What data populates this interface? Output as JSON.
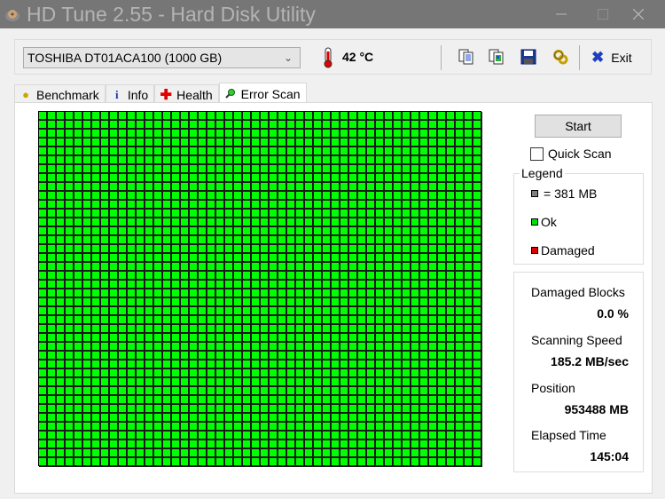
{
  "window": {
    "title": "HD Tune 2.55 - Hard Disk Utility",
    "controls": {
      "minimize": "—",
      "maximize": "☐",
      "close": "✕"
    }
  },
  "toolbar": {
    "drive": "TOSHIBA DT01ACA100 (1000 GB)",
    "temperature": "42 °C",
    "icons": [
      "copy-text-icon",
      "copy-screenshot-icon",
      "save-icon",
      "options-icon"
    ],
    "exit_label": "Exit"
  },
  "tabs": [
    {
      "label": "Benchmark",
      "icon": "benchmark-icon",
      "active": false
    },
    {
      "label": "Info",
      "icon": "info-icon",
      "active": false
    },
    {
      "label": "Health",
      "icon": "health-icon",
      "active": false
    },
    {
      "label": "Error Scan",
      "icon": "error-scan-icon",
      "active": true
    }
  ],
  "error_scan": {
    "start_label": "Start",
    "quick_scan_label": "Quick Scan",
    "quick_scan_checked": false,
    "legend": {
      "title": "Legend",
      "items": [
        {
          "label": "= 381 MB",
          "color": "#808080"
        },
        {
          "label": "Ok",
          "color": "#00e000"
        },
        {
          "label": "Damaged",
          "color": "#e00000"
        }
      ]
    },
    "stats": [
      {
        "label": "Damaged Blocks",
        "value": "0.0 %"
      },
      {
        "label": "Scanning Speed",
        "value": "185.2 MB/sec"
      },
      {
        "label": "Position",
        "value": "953488 MB"
      },
      {
        "label": "Elapsed Time",
        "value": "145:04"
      }
    ],
    "grid": {
      "columns": 50,
      "rows": 40,
      "status": "all-ok",
      "ok_color": "#00ff00",
      "damaged_color": "#e00000",
      "damaged_blocks": []
    }
  }
}
